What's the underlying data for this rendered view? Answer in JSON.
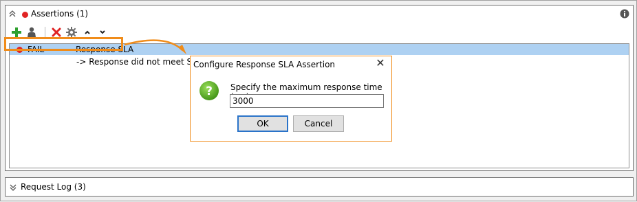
{
  "assertions_panel": {
    "title": "Assertions (1)",
    "toolbar": {
      "add": "add-icon",
      "add_from_user": "user-icon",
      "delete": "delete-icon",
      "configure": "gear-icon",
      "move_up": "move-up-icon",
      "move_down": "move-down-icon"
    },
    "rows": [
      {
        "status": "FAIL",
        "name": "Response SLA",
        "message": "-> Response did not meet SLA"
      }
    ]
  },
  "dialog": {
    "title": "Configure Response SLA Assertion",
    "label": "Specify the maximum response time (ms)",
    "value": "3000",
    "ok_label": "OK",
    "cancel_label": "Cancel"
  },
  "request_log_panel": {
    "title": "Request Log (3)"
  },
  "colors": {
    "highlight": "#f08c1a",
    "fail": "#e02424",
    "selection": "#aed1f2",
    "add": "#2ea02e",
    "delete": "#e02424"
  }
}
